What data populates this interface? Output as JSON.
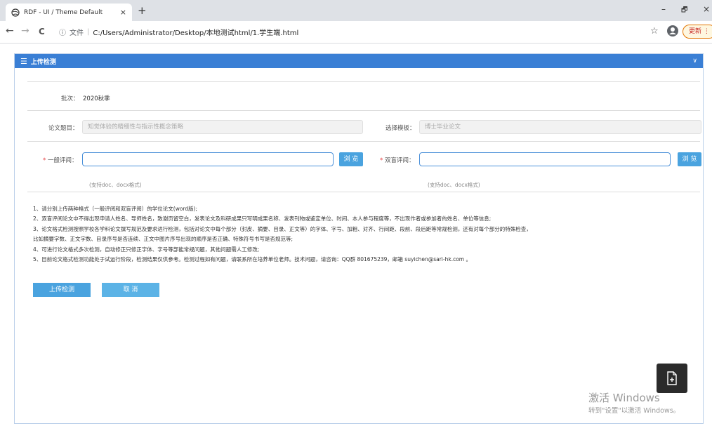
{
  "browser": {
    "tab_title": "RDF - UI / Theme Default",
    "tab_close": "×",
    "new_tab": "+",
    "minimize": "–",
    "maximize": "🗗",
    "close": "×",
    "back": "←",
    "forward": "→",
    "reload": "C",
    "info_icon": "ⓘ",
    "file_label": "文件",
    "url_sep": "|",
    "url": "C:/Users/Administrator/Desktop/本地测试html/1.学生端.html",
    "star": "☆",
    "update_label": "更新 ⋮"
  },
  "panel": {
    "menu_icon": "☰",
    "title": "上传检测",
    "collapse_icon": "∨"
  },
  "form": {
    "batch_label": "批次：",
    "batch_value": "2020秋季",
    "title_label": "论文题目：",
    "title_value": "知觉体验的精细性与指示性概念策略",
    "template_label": "选择模板：",
    "template_value": "博士毕业论文",
    "required_mark": "*",
    "general_label": "一般评阅：",
    "blind_label": "双盲评阅：",
    "browse_label": "浏 览",
    "format_hint": "(支持doc、docx格式)"
  },
  "notes": [
    "1、请分别上传两种格式（一般评阅和双盲评阅）的学位论文(word版);",
    "2、双盲评阅论文中不得出现申请人姓名、导师姓名，致谢页留空白，发表论文及科研成果只写明成果名称、发表刊物或鉴定单位、时间、本人参与程度等，不出现作者或参加者的姓名、单位等信息;",
    "3、论文格式检测按照学校各学科论文撰写规范及要求进行检测，包括对论文中每个部分（封皮、摘要、目录、正文等）的字体、字号、加粗、对齐、行间距、段前、段后距等常规检测，还有对每个部分的特殊检查，",
    "    比如摘要字数、正文字数、目录序号是否连续、正文中图片序号出现的顺序是否正确、特殊符号书写是否规范等;",
    "4、可进行论文格式多次检测，自动修正只修正字体、字号等部能常规问题，其他问题需人工修改;",
    "5、目前论文格式检测功能处于试运行阶段，检测结果仅供参考。检测过程如有问题，请联系所在培养单位老师。技术问题，请咨询：QQ群 801675239，邮箱 suyichen@sari-hk.com 。"
  ],
  "actions": {
    "upload_label": "上传检测",
    "cancel_label": "取 消"
  },
  "watermark": {
    "line1": "激活 Windows",
    "line2": "转到\"设置\"以激活 Windows。"
  }
}
